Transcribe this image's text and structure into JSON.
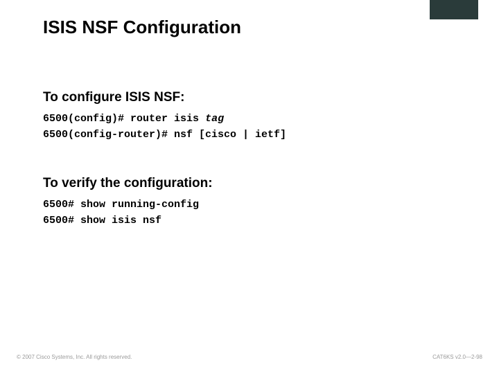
{
  "slide": {
    "title": "ISIS NSF Configuration"
  },
  "configure": {
    "heading": "To configure ISIS NSF:",
    "line1_prompt": "6500(config)# ",
    "line1_cmd": "router isis ",
    "line1_arg": "tag",
    "line2_prompt": "6500(config-router)# ",
    "line2_cmd": "nsf [cisco | ietf]"
  },
  "verify": {
    "heading": "To verify the configuration:",
    "line1": "6500# show running-config",
    "line2": "6500# show isis nsf"
  },
  "footer": {
    "left": "© 2007 Cisco Systems, Inc. All rights reserved.",
    "right": "CAT6KS v2.0—2-98"
  }
}
